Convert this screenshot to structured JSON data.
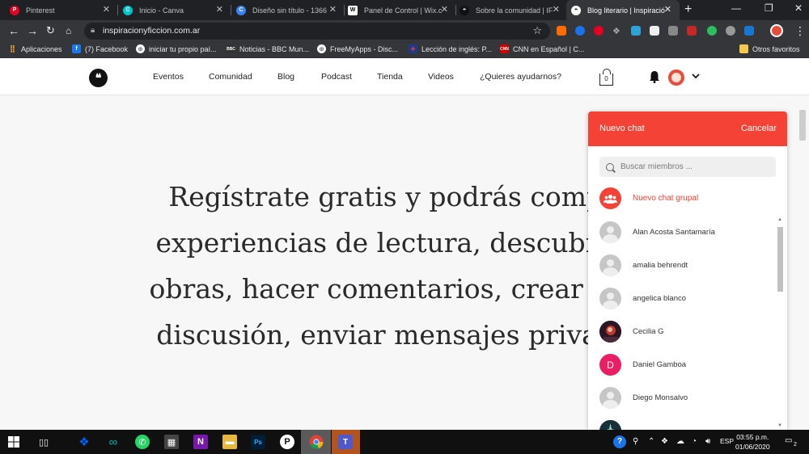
{
  "browser": {
    "tabs": [
      {
        "label": "Pinterest",
        "icon": "pinterest-icon",
        "color": "#e60023"
      },
      {
        "label": "Inicio - Canva",
        "icon": "canva-icon",
        "color": "#00c4cc"
      },
      {
        "label": "Diseño sin título - 1366",
        "icon": "canva-icon",
        "color": "#00c4cc"
      },
      {
        "label": "Panel de Control | Wix.c",
        "icon": "wix-icon",
        "color": "#ffffff"
      },
      {
        "label": "Sobre la comunidad | IF",
        "icon": "if-icon",
        "color": "#111111"
      },
      {
        "label": "Blog literario | Inspiració",
        "icon": "if-icon",
        "color": "#111111"
      }
    ],
    "address": {
      "url": "inspiracionyficcion.com.ar"
    },
    "bookmarks": [
      {
        "label": "Aplicaciones",
        "icon": "apps-grid-icon"
      },
      {
        "label": "(7) Facebook",
        "icon": "facebook-icon"
      },
      {
        "label": "iniciar tu propio paí...",
        "icon": "globe-icon"
      },
      {
        "label": "Noticias - BBC Mun...",
        "icon": "bbc-icon"
      },
      {
        "label": "FreeMyApps - Disc...",
        "icon": "globe-icon"
      },
      {
        "label": "Lección de inglés: P...",
        "icon": "flag-icon"
      },
      {
        "label": "CNN en Español | C...",
        "icon": "cnn-icon"
      },
      {
        "label": "Otros favoritos",
        "icon": "folder-icon"
      }
    ]
  },
  "site": {
    "logo_text": "❝",
    "nav": [
      "Eventos",
      "Comunidad",
      "Blog",
      "Podcast",
      "Tienda",
      "Videos",
      "¿Quieres ayudarnos?"
    ],
    "cart_count": "0"
  },
  "hero": {
    "lines": [
      "Regístrate gratis y podrás compar",
      "experiencias de lectura, descubrir n",
      "obras, hacer comentarios, crear un g",
      "discusión, enviar mensajes privados"
    ]
  },
  "chat": {
    "title": "Nuevo chat",
    "cancel": "Cancelar",
    "search_placeholder": "Buscar miembros ...",
    "group_label": "Nuevo chat grupal",
    "accent": "#f44336",
    "members": [
      {
        "name": "Alan Acosta Santamaría",
        "avatar": "default"
      },
      {
        "name": "amalia behrendt",
        "avatar": "default"
      },
      {
        "name": "angelica blanco",
        "avatar": "default"
      },
      {
        "name": "Cecilia G",
        "avatar": "photo"
      },
      {
        "name": "Daniel Gamboa",
        "avatar": "letter",
        "letter": "D"
      },
      {
        "name": "Diego Monsalvo",
        "avatar": "default"
      },
      {
        "name": "",
        "avatar": "photo"
      }
    ]
  },
  "taskbar": {
    "lang": "ESP",
    "time": "03:55 p.m.",
    "date": "01/06/2020",
    "notif_count": "2"
  }
}
